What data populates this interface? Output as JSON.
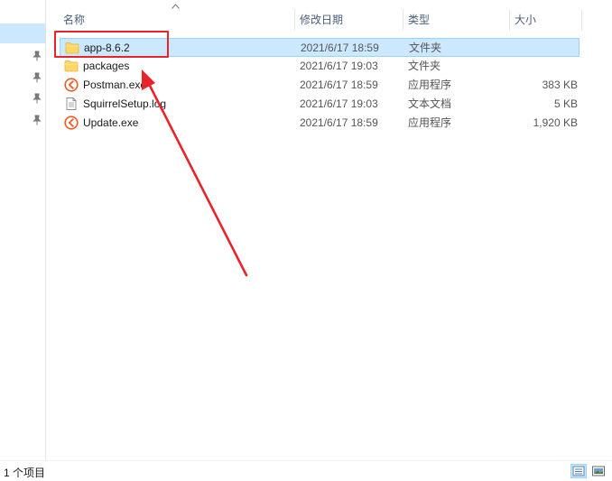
{
  "header": {
    "name": "名称",
    "date_modified": "修改日期",
    "type": "类型",
    "size": "大小"
  },
  "files": [
    {
      "name": "app-8.6.2",
      "date": "2021/6/17 18:59",
      "type": "文件夹",
      "size": "",
      "icon": "folder-icon",
      "selected": true
    },
    {
      "name": "packages",
      "date": "2021/6/17 19:03",
      "type": "文件夹",
      "size": "",
      "icon": "folder-icon",
      "selected": false
    },
    {
      "name": "Postman.exe",
      "date": "2021/6/17 18:59",
      "type": "应用程序",
      "size": "383 KB",
      "icon": "postman-icon",
      "selected": false
    },
    {
      "name": "SquirrelSetup.log",
      "date": "2021/6/17 19:03",
      "type": "文本文档",
      "size": "5 KB",
      "icon": "text-file-icon",
      "selected": false
    },
    {
      "name": "Update.exe",
      "date": "2021/6/17 18:59",
      "type": "应用程序",
      "size": "1,920 KB",
      "icon": "postman-icon",
      "selected": false
    }
  ],
  "status": {
    "item_count": "1 个项目"
  },
  "colors": {
    "selection": "#cce8ff",
    "selection_border": "#99d1ff",
    "annotation": "#e8232a",
    "folder": "#ffd766",
    "postman": "#ef5b25"
  }
}
